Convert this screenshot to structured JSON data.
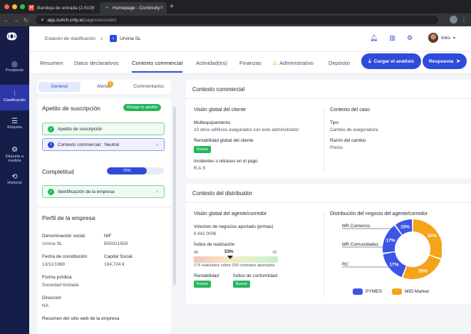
{
  "browser": {
    "tabs": [
      {
        "label": "Bandeja de entrada (2.619)",
        "icon": "gmail-icon"
      },
      {
        "label": "Homepage - Continuity",
        "icon": "continuity-icon"
      }
    ],
    "new_tab": "+",
    "url_host": "app.zurich.cnty.ai",
    "url_path": "/pages/assistant"
  },
  "sidenav": {
    "items": [
      {
        "label": "Prospecto",
        "icon": "target-icon"
      },
      {
        "label": "Clasificación",
        "icon": "sliders-icon"
      },
      {
        "label": "Etiqueta",
        "icon": "tag-list-icon"
      },
      {
        "label": "Etiqueta a medida",
        "icon": "custom-tag-icon"
      },
      {
        "label": "Historial",
        "icon": "history-icon"
      }
    ],
    "active_index": 1
  },
  "header": {
    "breadcrumb": "Estación de clasificación",
    "breadcrumb_sep": "›",
    "case_back": "‹",
    "case_name": "Urvina SL",
    "user_name": "Inés",
    "user_chevron": "▾"
  },
  "tabs": {
    "items": [
      "Resumen",
      "Datos declarativos",
      "Contexto commercial",
      "Actividad(es)",
      "Finanzas",
      "Administrativo",
      "Depósito"
    ],
    "active": "Contexto commercial",
    "btn_upload": "Cargar el análisis",
    "btn_answer": "Respuesta"
  },
  "left": {
    "pill_tabs": [
      "General",
      "Alertas",
      "Commentarios"
    ],
    "alert_count": "2",
    "apetito": {
      "title": "Apetito de suscripción",
      "badge": "Riesgo in apetito",
      "rows": [
        "Apetito de suscripción",
        "Contexto commercial : Neutral"
      ]
    },
    "completitud": {
      "title": "Completitud",
      "progress": 70,
      "progress_label": "70%",
      "row": "Identificación de la empresa"
    },
    "perfil": {
      "title": "Perfil de la empresa",
      "fields": [
        {
          "label": "Denominación social",
          "value": "Urvina SL"
        },
        {
          "label": "NIF",
          "value": "B50021658"
        },
        {
          "label": "Fecha de constitución",
          "value": "13/11/1969"
        },
        {
          "label": "Capital Social",
          "value": "194,724 €"
        },
        {
          "label": "Forma jurídica",
          "value": "Sociedad limitada"
        },
        {
          "label": "Dirección",
          "value": "NA"
        },
        {
          "label": "Resumen del sitio web de la empresa",
          "value": ""
        }
      ]
    }
  },
  "right": {
    "ctx": {
      "title": "Contexto commercial",
      "vision_title": "Visión global del cliente",
      "multi_label": "Multiequipamiento",
      "multi_value": "10 otros edificios asegurados con este administrador",
      "rent_label": "Rentabilidad global del cliente",
      "rent_badge": "Buena",
      "inc_label": "Incidentes o retrasos en el pago",
      "inc_value": "R.A.S",
      "caso_title": "Contexto del caso",
      "tipo_label": "Tipo",
      "tipo_value": "Cambio de aseguradora",
      "razon_label": "Razón del cambio",
      "razon_value": "Precio"
    },
    "dist": {
      "title": "Contexto del distribuidor",
      "vision_title": "Visión global del agente/corredor",
      "vol_label": "Volumen de negocios aportado (primas)",
      "vol_value": "8 842 000€",
      "idx_label": "Índice de realización",
      "idx_min": "40",
      "idx_value": "53%",
      "idx_max": "70",
      "idx_pct": 53,
      "idx_range": [
        40,
        70
      ],
      "idx_note": "175 realizados sobre 330 contratos aportados",
      "rent_label": "Rentabilidad",
      "rent_badge": "Buena",
      "conf_label": "Índice de conformidad",
      "conf_badge": "Bueno",
      "chart_title": "Distribución del negocio del agente/corredor"
    }
  },
  "chart_data": {
    "type": "pie",
    "title": "Distribución del negocio del agente/corredor",
    "categories": [
      "MR Comercio",
      "MR Comunidades",
      "RC"
    ],
    "series": [
      {
        "name": "PYMES",
        "color": "#3d55e6",
        "values": [
          10,
          17,
          17
        ]
      },
      {
        "name": "MID Market",
        "color": "#f5a31a",
        "values": [
          30,
          25,
          0
        ]
      }
    ],
    "slices": [
      {
        "label": "30%",
        "value": 30,
        "series": "MID Market",
        "color": "#f5a31a"
      },
      {
        "label": "25%",
        "value": 25,
        "series": "MID Market",
        "color": "#f5a31a"
      },
      {
        "label": "17%",
        "value": 17,
        "series": "PYMES",
        "color": "#3d55e6"
      },
      {
        "label": "17%",
        "value": 17,
        "series": "PYMES",
        "color": "#3d55e6"
      },
      {
        "label": "10%",
        "value": 10,
        "series": "PYMES",
        "color": "#3d55e6"
      }
    ],
    "legend": [
      "PYMES",
      "MID Market"
    ],
    "legend_position": "bottom"
  },
  "colors": {
    "accent": "#2f4bd9",
    "nav": "#161d49",
    "success": "#27b55c",
    "warning": "#f5a31a"
  }
}
